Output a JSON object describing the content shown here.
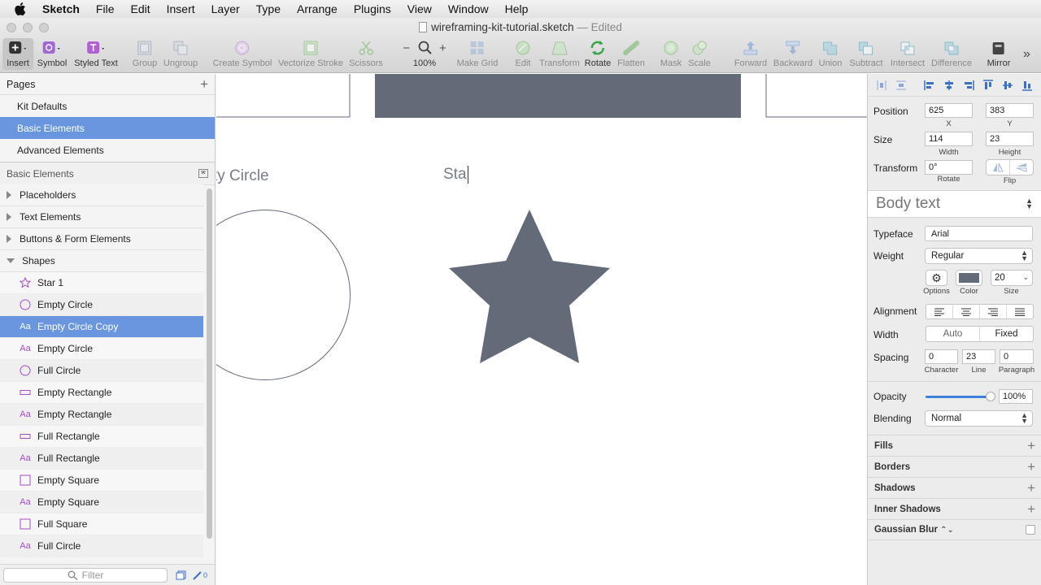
{
  "menubar": {
    "app_name": "Sketch",
    "items": [
      "File",
      "Edit",
      "Insert",
      "Layer",
      "Type",
      "Arrange",
      "Plugins",
      "View",
      "Window",
      "Help"
    ]
  },
  "window": {
    "filename": "wireframing-kit-tutorial.sketch",
    "status": "— Edited"
  },
  "toolbar": {
    "insert": "Insert",
    "symbol": "Symbol",
    "styled_text": "Styled Text",
    "group": "Group",
    "ungroup": "Ungroup",
    "create_symbol": "Create Symbol",
    "vectorize_stroke": "Vectorize Stroke",
    "scissors": "Scissors",
    "zoom_minus": "−",
    "zoom_value": "100%",
    "zoom_plus": "+",
    "make_grid": "Make Grid",
    "edit": "Edit",
    "transform": "Transform",
    "rotate": "Rotate",
    "flatten": "Flatten",
    "mask": "Mask",
    "scale": "Scale",
    "forward": "Forward",
    "backward": "Backward",
    "union": "Union",
    "subtract": "Subtract",
    "intersect": "Intersect",
    "difference": "Difference",
    "mirror": "Mirror"
  },
  "pages": {
    "header": "Pages",
    "items": [
      "Kit Defaults",
      "Basic Elements",
      "Advanced Elements"
    ],
    "selected": "Basic Elements"
  },
  "layers": {
    "page_title": "Basic Elements",
    "groups": [
      "Placeholders",
      "Text Elements",
      "Buttons & Form Elements",
      "Shapes"
    ],
    "shapes": [
      {
        "name": "Star 1",
        "icon": "star-icon"
      },
      {
        "name": "Empty Circle",
        "icon": "circle-icon"
      },
      {
        "name": "Empty Circle Copy",
        "icon": "text-icon"
      },
      {
        "name": "Empty Circle",
        "icon": "text-icon"
      },
      {
        "name": "Full Circle",
        "icon": "circle-icon"
      },
      {
        "name": "Empty Rectangle",
        "icon": "rectangle-icon"
      },
      {
        "name": "Empty Rectangle",
        "icon": "text-icon"
      },
      {
        "name": "Full Rectangle",
        "icon": "rectangle-icon"
      },
      {
        "name": "Full Rectangle",
        "icon": "text-icon"
      },
      {
        "name": "Empty Square",
        "icon": "square-icon"
      },
      {
        "name": "Empty Square",
        "icon": "text-icon"
      },
      {
        "name": "Full Square",
        "icon": "square-icon"
      },
      {
        "name": "Full Circle",
        "icon": "text-icon"
      }
    ],
    "text_icon_glyph": "Aa",
    "filter_placeholder": "Filter",
    "badge_count": "0"
  },
  "canvas": {
    "label_circle": "ty Circle",
    "label_star": "Sta",
    "shape_color": "#636a78"
  },
  "inspector": {
    "position_label": "Position",
    "x": "625",
    "y": "383",
    "x_label": "X",
    "y_label": "Y",
    "size_label": "Size",
    "width": "114",
    "height": "23",
    "width_label": "Width",
    "height_label": "Height",
    "transform_label": "Transform",
    "rotate_value": "0°",
    "rotate_label": "Rotate",
    "flip_label": "Flip",
    "text_style": "Body text",
    "typeface_label": "Typeface",
    "typeface": "Arial",
    "weight_label": "Weight",
    "weight": "Regular",
    "options_label": "Options",
    "color_label": "Color",
    "size_sub_label": "Size",
    "font_size": "20",
    "alignment_label": "Alignment",
    "width_mode_label": "Width",
    "width_auto": "Auto",
    "width_fixed": "Fixed",
    "spacing_label": "Spacing",
    "character": "0",
    "line": "23",
    "paragraph": "0",
    "character_label": "Character",
    "line_label": "Line",
    "paragraph_label": "Paragraph",
    "opacity_label": "Opacity",
    "opacity": "100%",
    "opacity_fraction": 1.0,
    "blending_label": "Blending",
    "blending": "Normal",
    "sections": [
      "Fills",
      "Borders",
      "Shadows",
      "Inner Shadows",
      "Gaussian Blur"
    ],
    "accent_color": "#6a96e0",
    "text_color_swatch": "#636a78"
  }
}
